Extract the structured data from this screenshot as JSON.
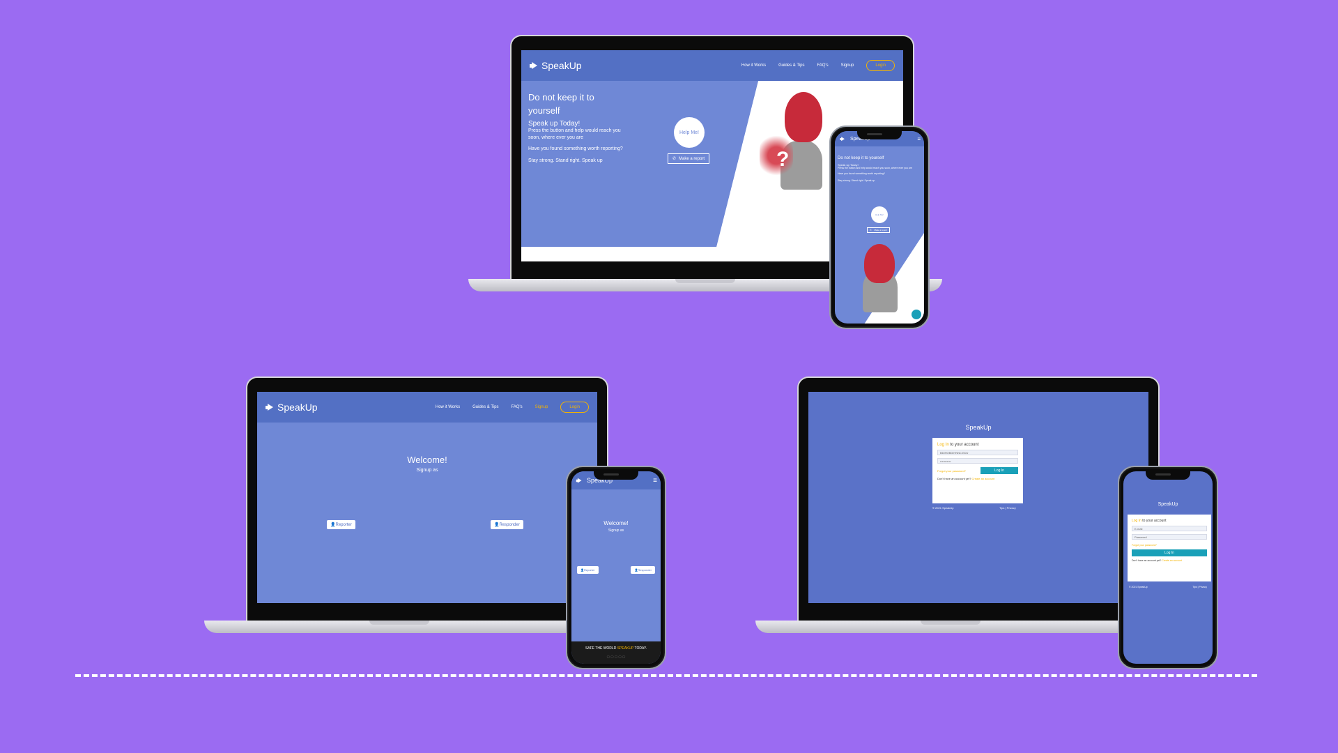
{
  "brand": {
    "name": "SpeakUp"
  },
  "nav": {
    "how_it_works": "How it Works",
    "guides": "Guides & Tips",
    "faqs": "FAQ's",
    "signup": "Signup",
    "login": "Login"
  },
  "hero": {
    "heading": "Do not keep it to yourself",
    "subheading": "Speak up Today!",
    "line1": "Press the button and help would reach you soon, where ever you are",
    "line2": "Have you found something worth reporting?",
    "line3": "Stay strong. Stand right. Speak up",
    "help_button": "Help Me!",
    "report_button": "Make a report"
  },
  "signup": {
    "title": "Welcome!",
    "subtitle": "Signup as",
    "reporter": "Reporter",
    "responder": "Responder",
    "footer_prefix": "SAFE THE WORLD ",
    "footer_brand": "SPEAKUP",
    "footer_suffix": " TODAY."
  },
  "login": {
    "title": "SpeakUp",
    "card_prefix": "Log In",
    "card_suffix": " to your account",
    "email_value": "BDIHOBDIHNNC.EDU",
    "email_placeholder": "E-mail",
    "password_value": "•••••••••••",
    "password_placeholder": "Password",
    "forgot": "Forgot your password?",
    "button": "Log In",
    "no_account": "Don't have an account yet? ",
    "create": "Create an account",
    "copyright": "© 2021 SpeakUp",
    "links": "Tips | Privacy"
  },
  "colors": {
    "background": "#9b6bf2",
    "site_blue": "#6f88d6",
    "nav_blue": "#5370c4",
    "accent": "#f4b400",
    "teal": "#1aa0b8"
  }
}
